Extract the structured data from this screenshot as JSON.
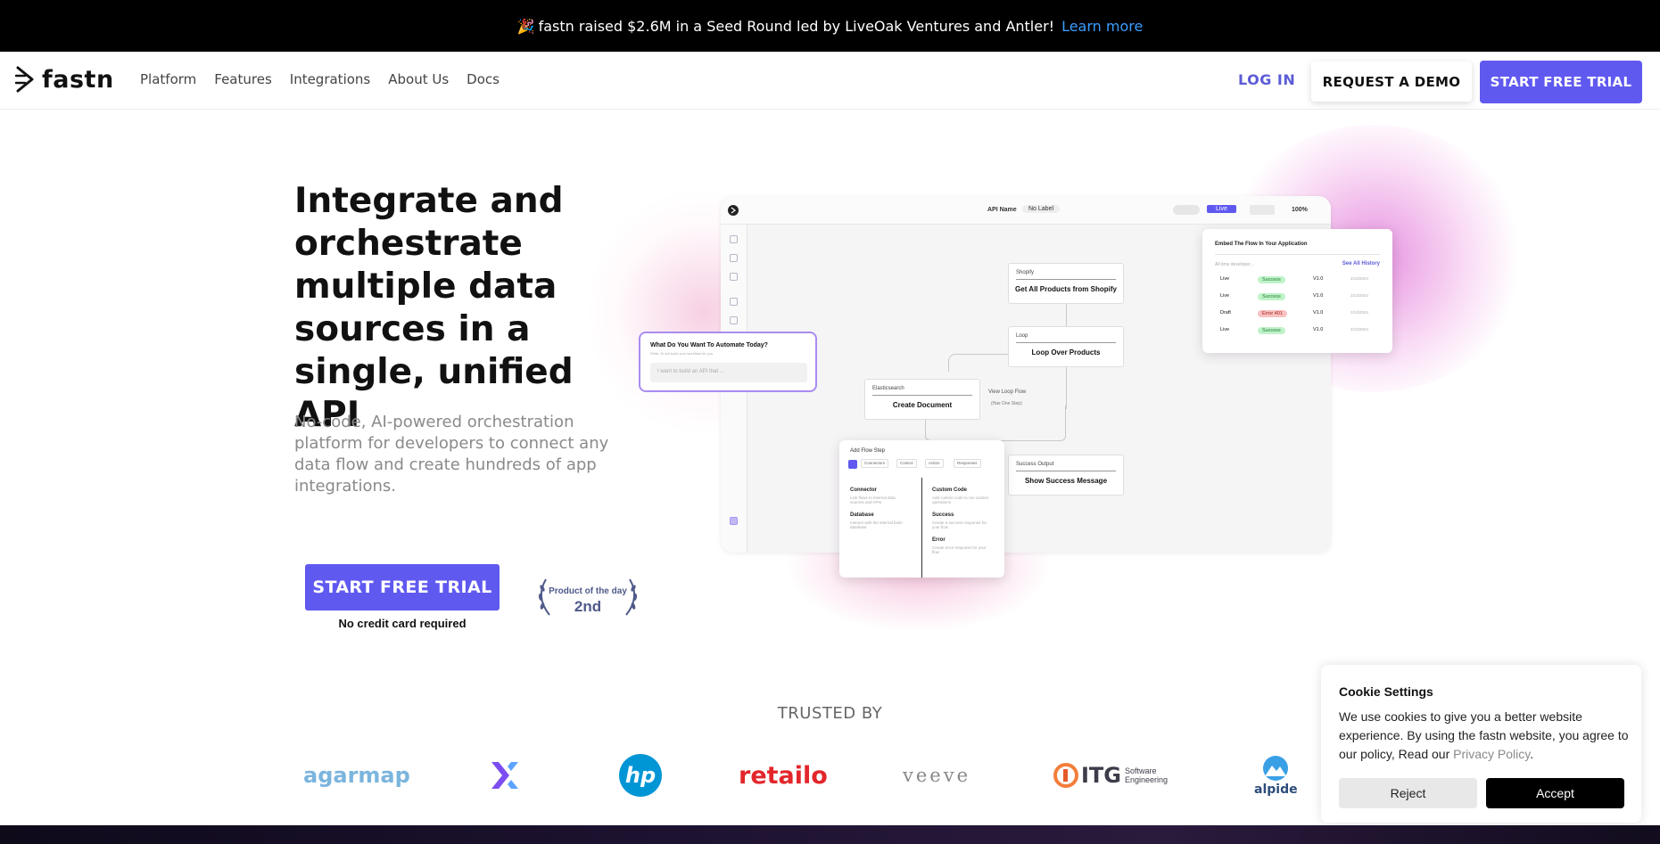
{
  "announcement": {
    "emoji": "🎉",
    "text": "fastn raised $2.6M in a Seed Round led by LiveOak Ventures and Antler!",
    "link": "Learn more"
  },
  "nav": {
    "logo": "fastn",
    "links": [
      "Platform",
      "Features",
      "Integrations",
      "About Us",
      "Docs"
    ],
    "login": "LOG IN",
    "demo": "REQUEST A DEMO",
    "trial": "START FREE TRIAL"
  },
  "hero": {
    "title": "Integrate and orchestrate multiple data sources in a single, unified API",
    "subtitle": "No-code, AI-powered orchestration platform for developers to connect any data flow and create hundreds of app integrations.",
    "cta": "START FREE TRIAL",
    "cta_note": "No credit card required",
    "badge_line1": "Product of the day",
    "badge_line2": "2nd"
  },
  "mockup": {
    "api_name_label": "API Name",
    "api_label_value": "No Label",
    "live_btn": "Live",
    "zoom": "100%",
    "nodes": {
      "shopify_hd": "Shopify",
      "shopify_ti": "Get All Products from Shopify",
      "loop_hd": "Loop",
      "loop_ti": "Loop Over Products",
      "es_hd": "Elasticsearch",
      "es_ti": "Create Document",
      "view_loop": "View Loop Flow",
      "view_loop_sub": "(Has One Step)",
      "success_hd": "Success Output",
      "success_ti": "Show Success Message"
    },
    "prompt": {
      "title": "What Do You Want To Automate Today?",
      "subtitle": "Write, AI will build your workflow for you",
      "placeholder": "I want to build an API that ..."
    },
    "history": {
      "title": "Embed The Flow In Your Application",
      "subtitle": "All time developer...",
      "see_all": "See All History",
      "rows": [
        {
          "env": "Live",
          "status": "Success",
          "ver": "V1.0",
          "date": "2/13/2024"
        },
        {
          "env": "Live",
          "status": "Success",
          "ver": "V1.0",
          "date": "2/13/2024"
        },
        {
          "env": "Draft",
          "status": "Error 401",
          "ver": "V1.0",
          "date": "2/13/2024"
        },
        {
          "env": "Live",
          "status": "Success",
          "ver": "V1.0",
          "date": "2/13/2024"
        }
      ]
    },
    "add_step": {
      "title": "Add Flow Step",
      "chips": [
        "Connectors",
        "Control",
        "Action",
        "Responses"
      ],
      "options": [
        {
          "name": "Connector",
          "desc": "Link flows to internal data sources and APIs"
        },
        {
          "name": "Database",
          "desc": "Interact with the internal fastn database"
        },
        {
          "name": "Custom Code",
          "desc": "Add custom code to run custom operations"
        },
        {
          "name": "Success",
          "desc": "Create a success response for your flow"
        },
        {
          "name": "Error",
          "desc": "Create error response for your flow"
        }
      ]
    }
  },
  "trusted": {
    "heading": "TRUSTED BY",
    "logos": [
      "agarmap",
      "X",
      "hp",
      "retailo",
      "veeve",
      "ITG",
      "Software Engineering",
      "alpide"
    ]
  },
  "cookie": {
    "title": "Cookie Settings",
    "body": "We use cookies to give you a better website experience. By using the fastn website, you agree to our policy, Read our",
    "policy_link": "Privacy Policy",
    "reject": "Reject",
    "accept": "Accept"
  },
  "colors": {
    "brand": "#6059f0",
    "link": "#3b9dff",
    "success": "#bff3c8",
    "error": "#f8c1c1"
  }
}
